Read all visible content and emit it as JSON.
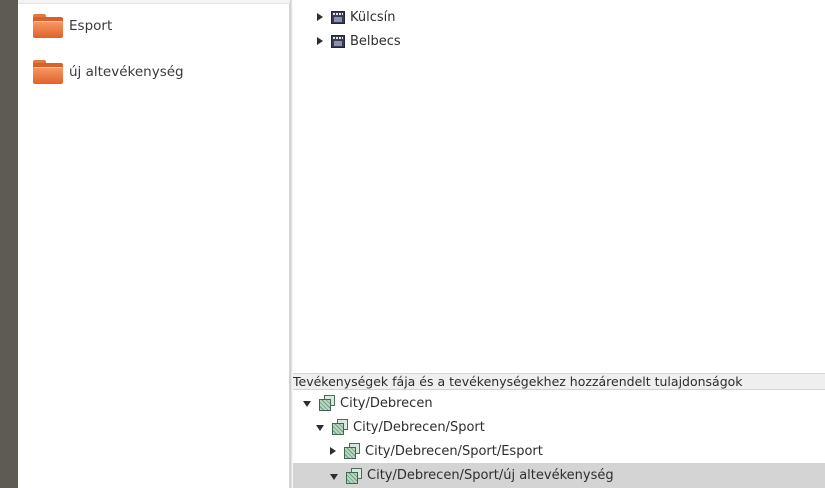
{
  "left_panel": {
    "folders": [
      {
        "label": "Esport",
        "icon": "folder-icon"
      },
      {
        "label": "új altevékenység",
        "icon": "folder-icon"
      }
    ]
  },
  "top_tree": {
    "items": [
      {
        "label": "Külcsín",
        "icon": "film-icon",
        "expanded": false
      },
      {
        "label": "Belbecs",
        "icon": "film-icon",
        "expanded": false
      }
    ]
  },
  "properties_panel": {
    "header": "Tevékenységek fája és a tevékenységekhez hozzárendelt tulajdonságok",
    "tree": [
      {
        "label": "City/Debrecen",
        "icon": "activity-icon",
        "expanded": true,
        "selected": false
      },
      {
        "label": "City/Debrecen/Sport",
        "icon": "activity-icon",
        "expanded": true,
        "selected": false
      },
      {
        "label": "City/Debrecen/Sport/Esport",
        "icon": "activity-icon",
        "expanded": false,
        "selected": false
      },
      {
        "label": "City/Debrecen/Sport/új altevékenység",
        "icon": "activity-icon",
        "expanded": true,
        "selected": true
      }
    ]
  },
  "colors": {
    "folder": "#e2602a",
    "selection": "#d4d4d4",
    "desktop_edge": "#5e5c52"
  }
}
